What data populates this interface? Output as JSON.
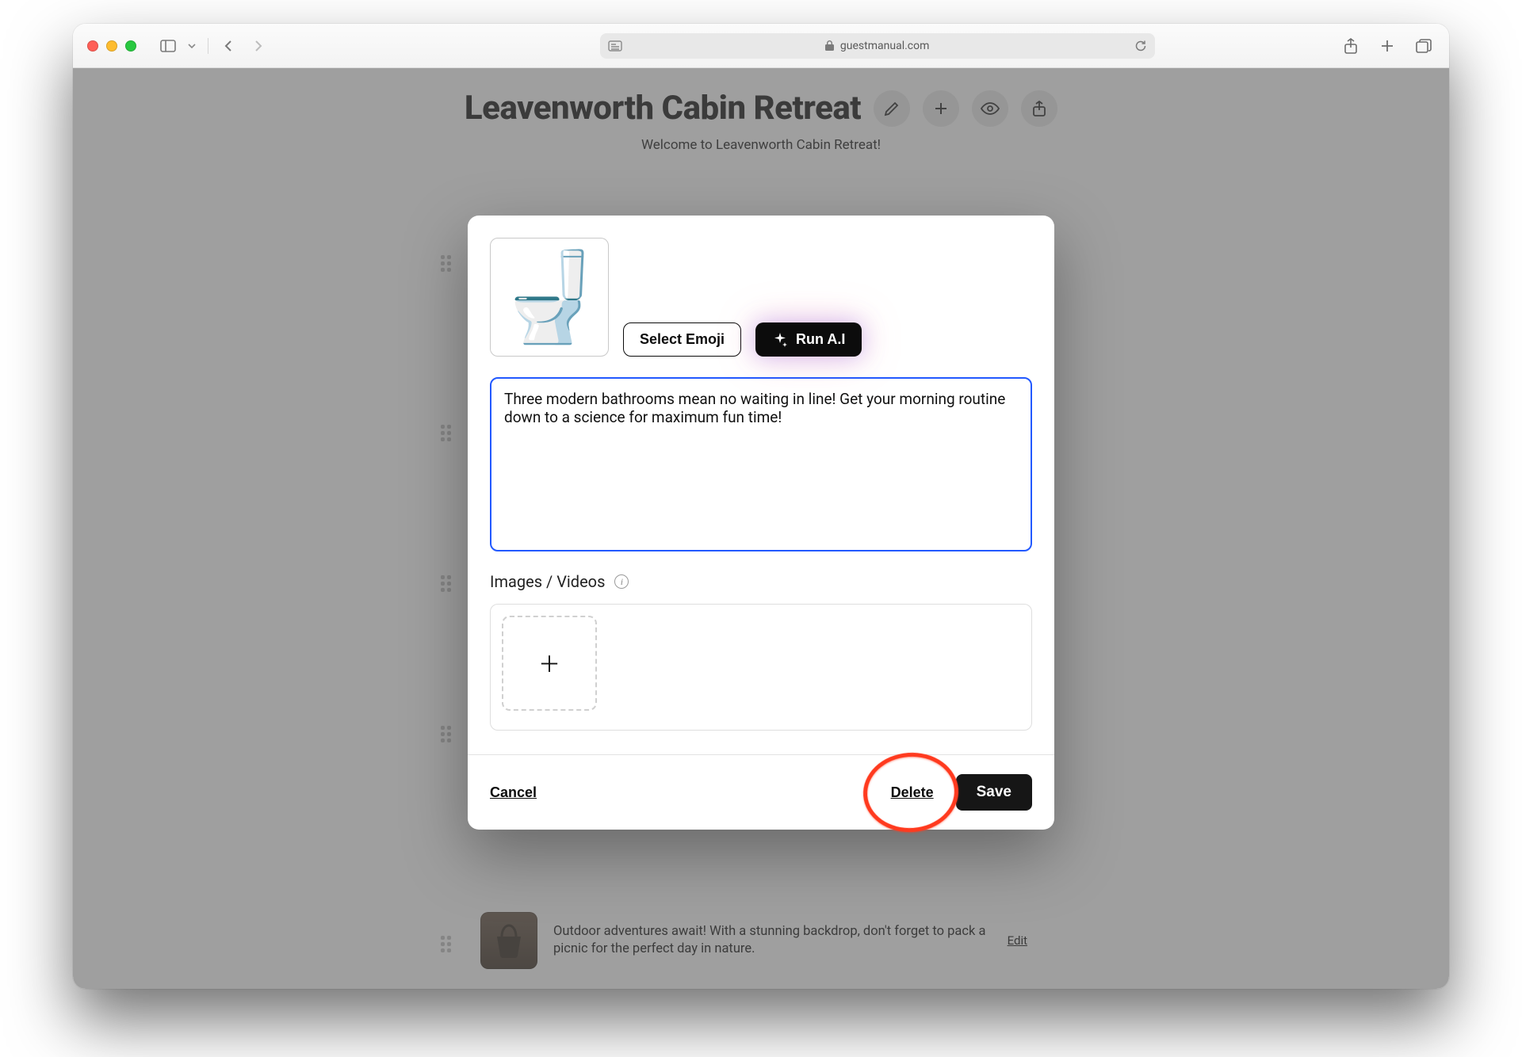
{
  "browser": {
    "url_host": "guestmanual.com"
  },
  "page": {
    "title": "Leavenworth Cabin Retreat",
    "welcome": "Welcome to Leavenworth Cabin Retreat!",
    "bg_item": {
      "text": "Outdoor adventures await! With a stunning backdrop, don't forget to pack a picnic for the perfect day in nature.",
      "edit": "Edit"
    }
  },
  "modal": {
    "emoji": "🚽",
    "select_emoji": "Select Emoji",
    "run_ai": "Run A.I",
    "description": "Three modern bathrooms mean no waiting in line! Get your morning routine down to a science for maximum fun time! ",
    "media_label": "Images / Videos",
    "add_glyph": "＋",
    "cancel": "Cancel",
    "delete": "Delete",
    "save": "Save"
  }
}
